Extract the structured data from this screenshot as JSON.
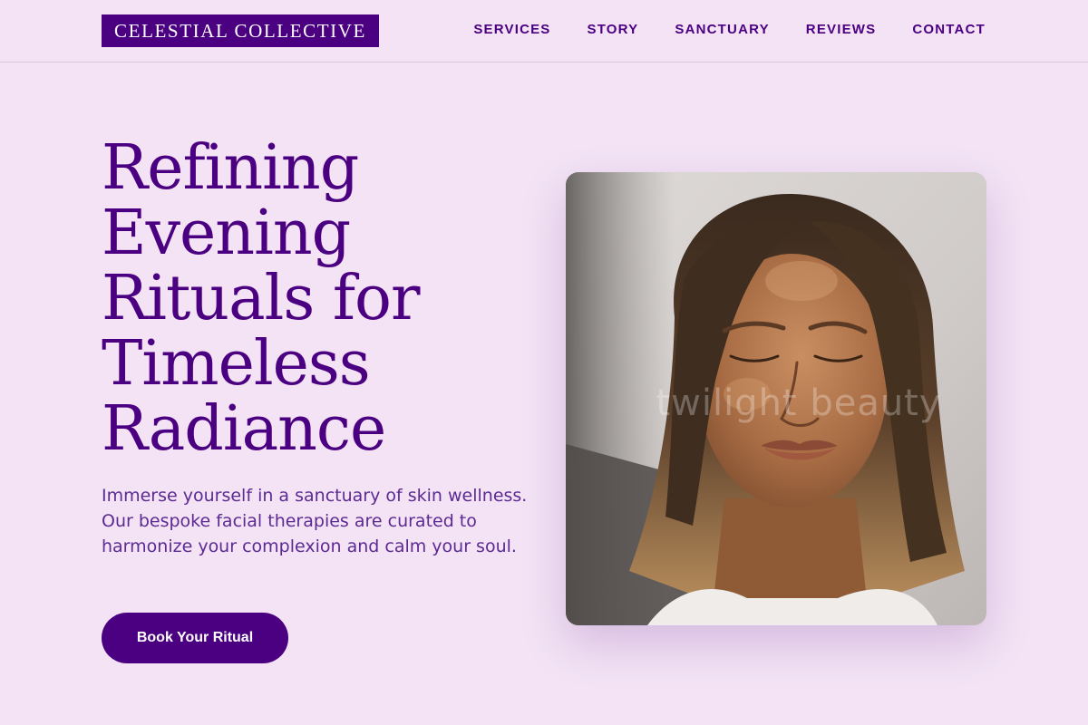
{
  "brand": {
    "name": "CELESTIAL COLLECTIVE"
  },
  "nav": {
    "items": [
      {
        "label": "SERVICES"
      },
      {
        "label": "STORY"
      },
      {
        "label": "SANCTUARY"
      },
      {
        "label": "REVIEWS"
      },
      {
        "label": "CONTACT"
      }
    ]
  },
  "hero": {
    "title_lines": [
      "Refining",
      "Evening",
      "Rituals for",
      "Timeless",
      "Radiance"
    ],
    "description": "Immerse yourself in a sanctuary of skin wellness. Our bespoke facial therapies are curated to harmonize your complexion and calm your soul.",
    "cta_label": "Book Your Ritual",
    "image": {
      "subject": "woman-with-closed-eyes-portrait",
      "watermark": "twilight beauty"
    }
  },
  "colors": {
    "background": "#f3e3f5",
    "accent": "#4b0082",
    "body_text": "#5c2a91",
    "button_text": "#ffffff"
  }
}
